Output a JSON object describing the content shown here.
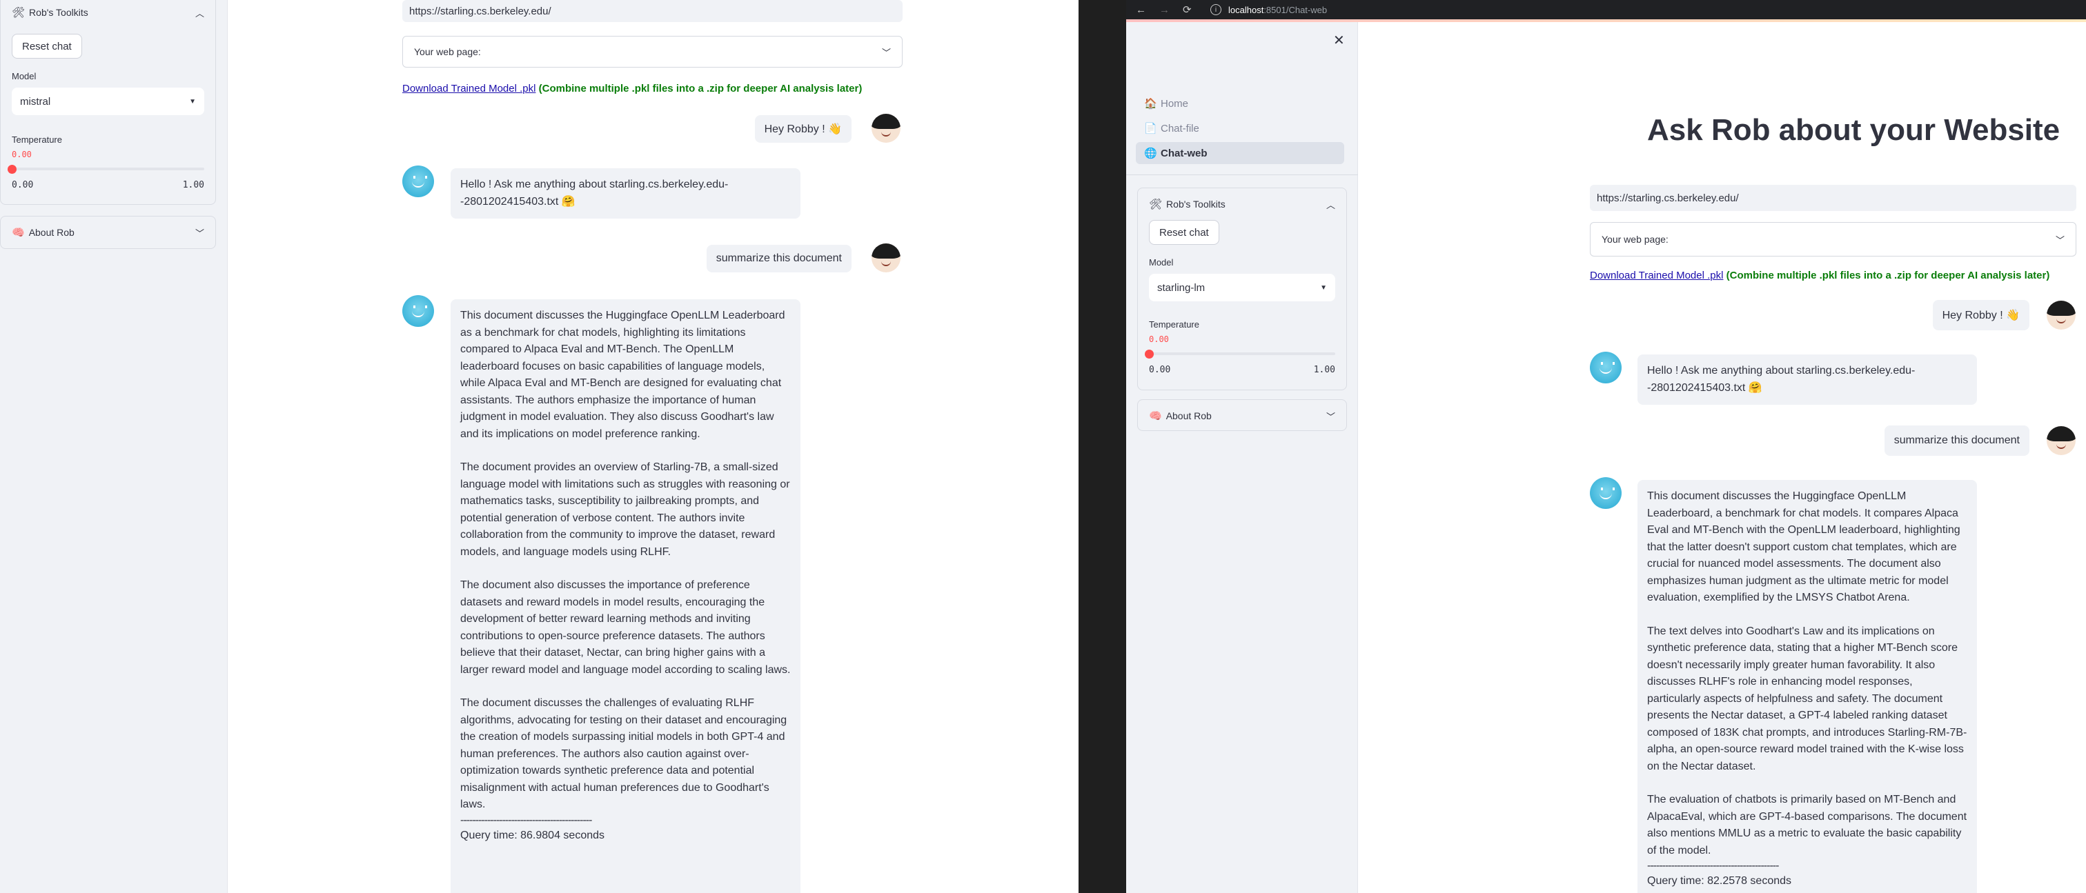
{
  "left": {
    "sidebar": {
      "toolkit_title": "Rob's Toolkits",
      "reset_label": "Reset chat",
      "model_label": "Model",
      "model_value": "mistral",
      "temperature_label": "Temperature",
      "temperature_value": "0.00",
      "slider_min": "0.00",
      "slider_max": "1.00",
      "temperature_level": 0,
      "about_title": "About Rob"
    },
    "url": "https://starling.cs.berkeley.edu/",
    "webpage_label": "Your web page:",
    "download_link": "Download Trained Model .pkl",
    "download_note": "(Combine multiple .pkl files into a .zip for deeper AI analysis later)",
    "messages": {
      "user1": "Hey Robby ! 👋",
      "bot1": "Hello ! Ask me anything about starling.cs.berkeley.edu--2801202415403.txt 🤗",
      "user2": "summarize this document",
      "bot2_p1": "This document discusses the Huggingface OpenLLM Leaderboard as a benchmark for chat models, highlighting its limitations compared to Alpaca Eval and MT-Bench. The OpenLLM leaderboard focuses on basic capabilities of language models, while Alpaca Eval and MT-Bench are designed for evaluating chat assistants. The authors emphasize the importance of human judgment in model evaluation. They also discuss Goodhart's law and its implications on model preference ranking.",
      "bot2_p2": "The document provides an overview of Starling-7B, a small-sized language model with limitations such as struggles with reasoning or mathematics tasks, susceptibility to jailbreaking prompts, and potential generation of verbose content. The authors invite collaboration from the community to improve the dataset, reward models, and language models using RLHF.",
      "bot2_p3": "The document also discusses the importance of preference datasets and reward models in model results, encouraging the development of better reward learning methods and inviting contributions to open-source preference datasets. The authors believe that their dataset, Nectar, can bring higher gains with a larger reward model and language model according to scaling laws.",
      "bot2_p4": "The document discusses the challenges of evaluating RLHF algorithms, advocating for testing on their dataset and encouraging the creation of models surpassing initial models in both GPT-4 and human preferences. The authors also caution against over-optimization towards synthetic preference data and potential misalignment with actual human preferences due to Goodhart's laws.",
      "rule": "--------------------------------------------",
      "query_time": "Query time: 86.9804 seconds"
    }
  },
  "right": {
    "browser": {
      "back": "←",
      "forward": "→",
      "reload": "⟳",
      "info": "i",
      "host": "localhost",
      "path": ":8501/Chat-web"
    },
    "nav": {
      "home": "Home",
      "chat_file": "Chat-file",
      "chat_web": "Chat-web"
    },
    "sidebar": {
      "toolkit_title": "Rob's Toolkits",
      "reset_label": "Reset chat",
      "model_label": "Model",
      "model_value": "starling-lm",
      "temperature_label": "Temperature",
      "temperature_value": "0.00",
      "slider_min": "0.00",
      "slider_max": "1.00",
      "temperature_level": 0,
      "about_title": "About Rob"
    },
    "title": "Ask Rob about your Website",
    "url": "https://starling.cs.berkeley.edu/",
    "webpage_label": "Your web page:",
    "download_link": "Download Trained Model .pkl",
    "download_note": "(Combine multiple .pkl files into a .zip for deeper AI analysis later)",
    "messages": {
      "user1": "Hey Robby ! 👋",
      "bot1": "Hello ! Ask me anything about starling.cs.berkeley.edu--2801202415403.txt 🤗",
      "user2": "summarize this document",
      "bot2_p1": "This document discusses the Huggingface OpenLLM Leaderboard, a benchmark for chat models. It compares Alpaca Eval and MT-Bench with the OpenLLM leaderboard, highlighting that the latter doesn't support custom chat templates, which are crucial for nuanced model assessments. The document also emphasizes human judgment as the ultimate metric for model evaluation, exemplified by the LMSYS Chatbot Arena.",
      "bot2_p2": "The text delves into Goodhart's Law and its implications on synthetic preference data, stating that a higher MT-Bench score doesn't necessarily imply greater human favorability. It also discusses RLHF's role in enhancing model responses, particularly aspects of helpfulness and safety. The document presents the Nectar dataset, a GPT-4 labeled ranking dataset composed of 183K chat prompts, and introduces Starling-RM-7B-alpha, an open-source reward model trained with the K-wise loss on the Nectar dataset.",
      "bot2_p3": "The evaluation of chatbots is primarily based on MT-Bench and AlpacaEval, which are GPT-4-based comparisons. The document also mentions MMLU as a metric to evaluate the basic capability of the model.",
      "rule": "--------------------------------------------",
      "query_time": "Query time: 82.2578 seconds"
    }
  },
  "icons": {
    "toolkit": "🛠",
    "about": "🧠",
    "home": "🏠",
    "file": "📄",
    "web": "🌐",
    "chevron_up": "︿",
    "chevron_down": "﹀",
    "caret": "▼",
    "close": "✕"
  }
}
